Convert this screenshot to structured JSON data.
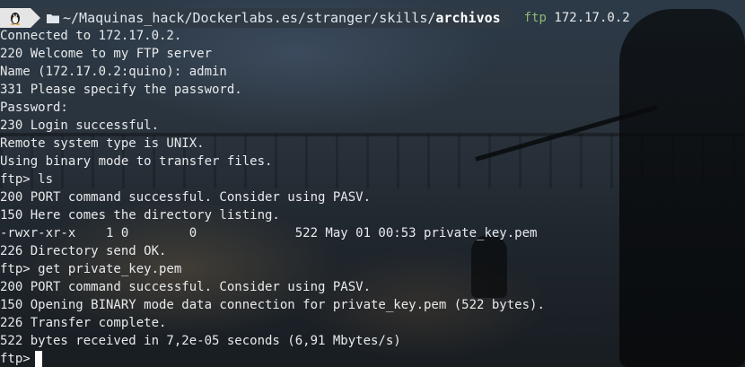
{
  "prompt": {
    "os_icon": "linux-tux-icon",
    "folder_icon": "folder-icon",
    "path_prefix": "~/Maquinas_hack/Dockerlabs.es/stranger/skills/",
    "path_current": "archivos",
    "command": "ftp",
    "argument": "172.17.0.2"
  },
  "lines": [
    "Connected to 172.17.0.2.",
    "220 Welcome to my FTP server",
    "Name (172.17.0.2:quino): admin",
    "331 Please specify the password.",
    "Password:",
    "230 Login successful.",
    "Remote system type is UNIX.",
    "Using binary mode to transfer files.",
    "ftp> ls",
    "200 PORT command successful. Consider using PASV.",
    "150 Here comes the directory listing.",
    "-rwxr-xr-x    1 0        0             522 May 01 00:53 private_key.pem",
    "226 Directory send OK.",
    "ftp> get private_key.pem",
    "200 PORT command successful. Consider using PASV.",
    "150 Opening BINARY mode data connection for private_key.pem (522 bytes).",
    "226 Transfer complete.",
    "522 bytes received in 7,2e-05 seconds (6,91 Mbytes/s)"
  ],
  "current_prompt": "ftp>",
  "colors": {
    "command": "#8fb873",
    "path_segment_bg": "#2f3a45",
    "os_segment_bg": "#e5e5e5"
  }
}
